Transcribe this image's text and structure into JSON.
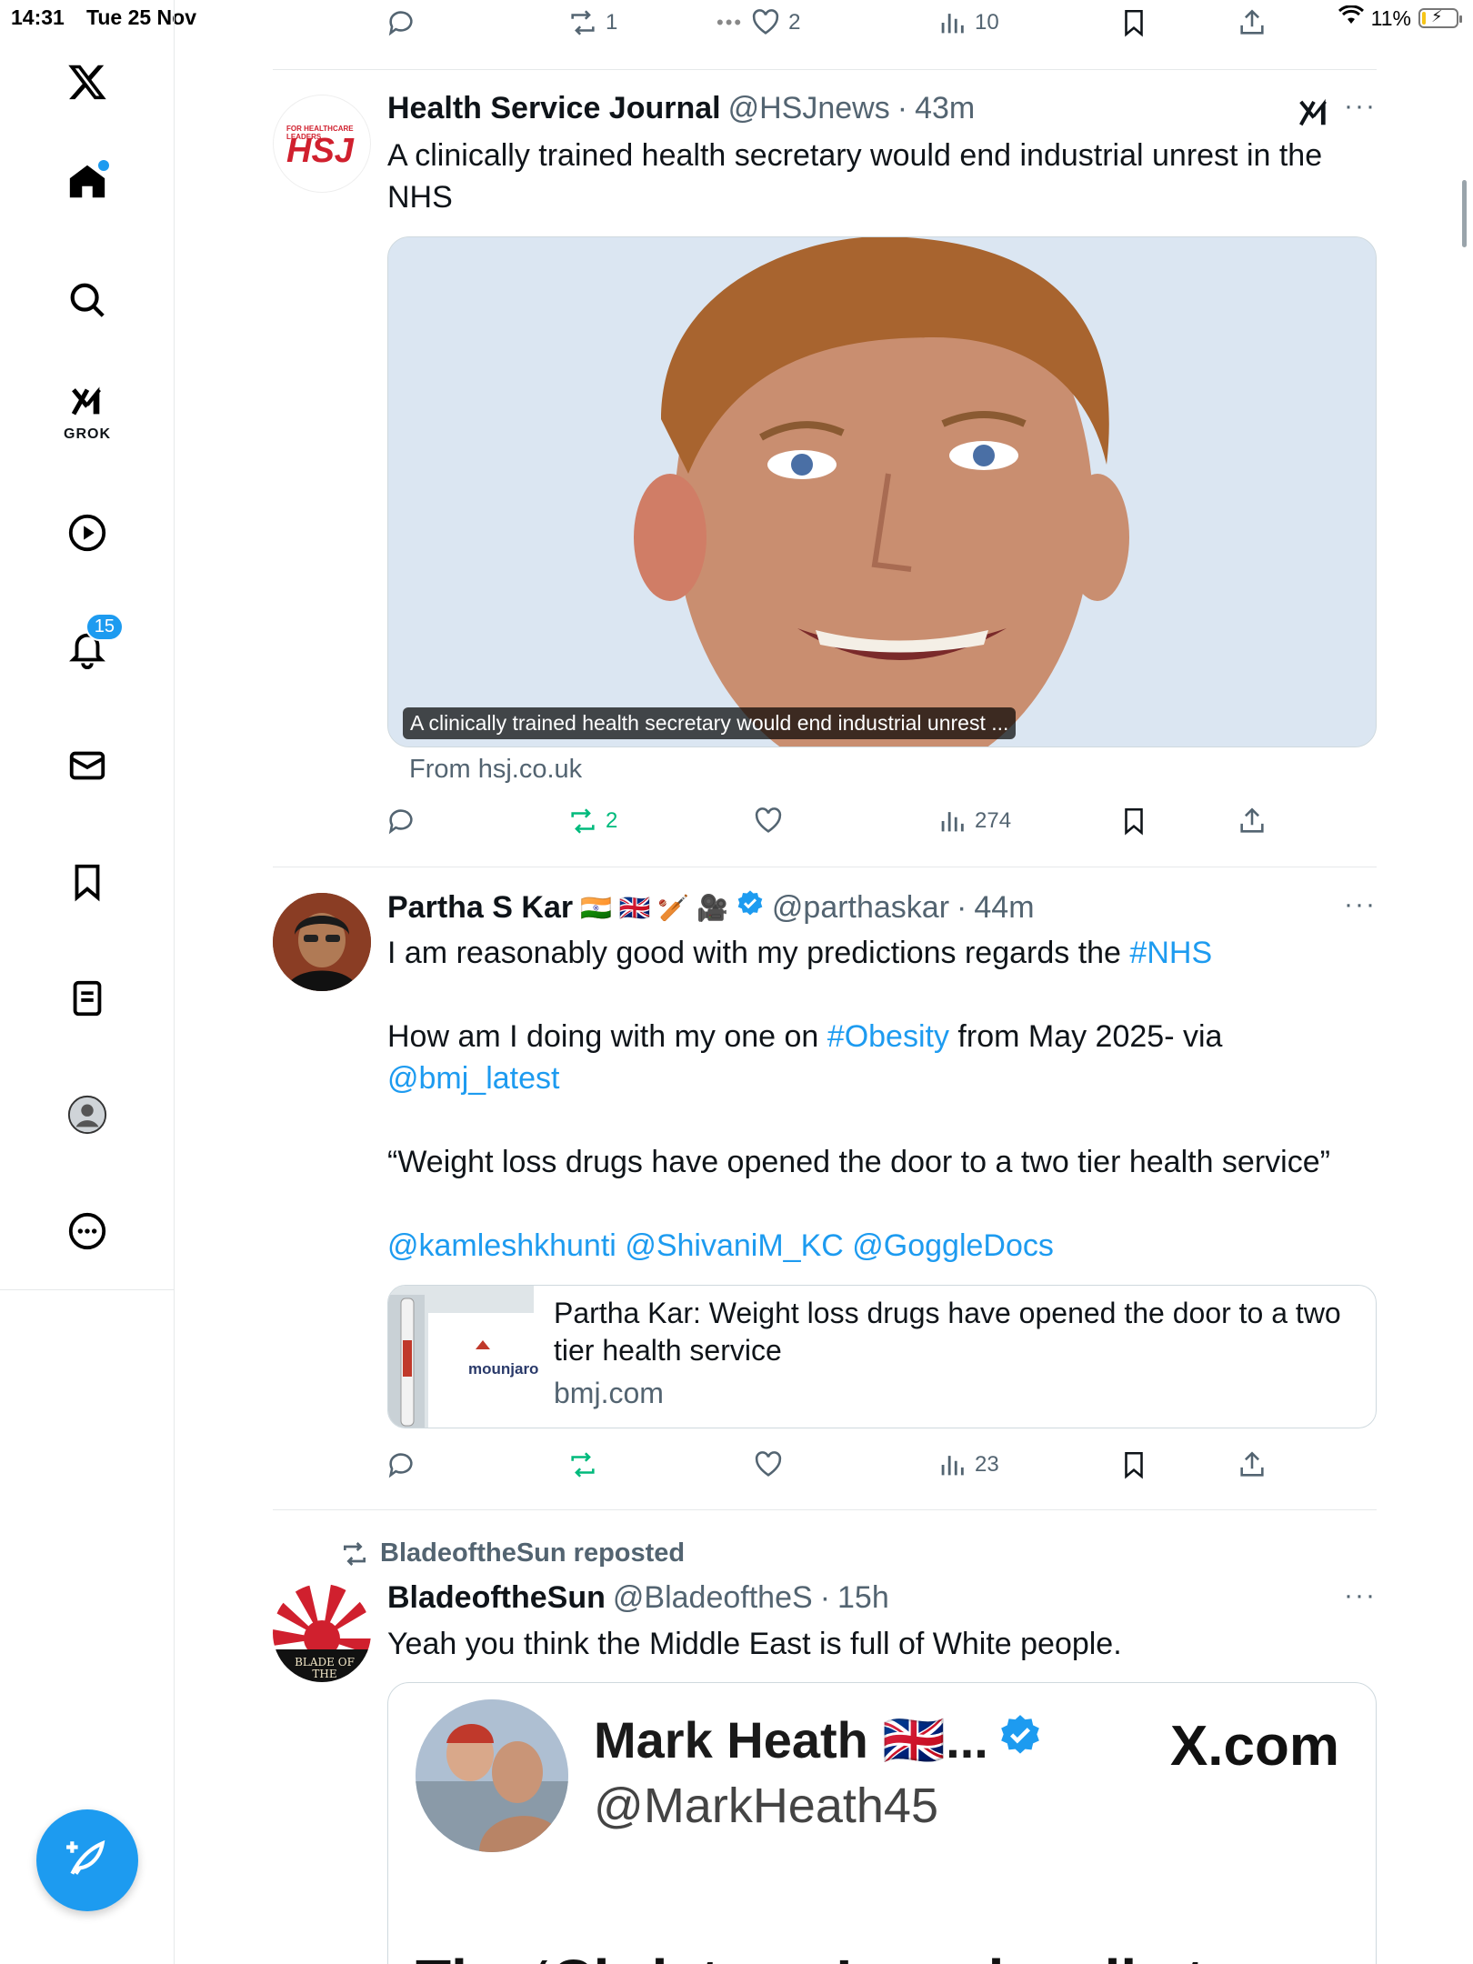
{
  "status_bar": {
    "time": "14:31",
    "date": "Tue 25 Nov",
    "battery": "11%",
    "battery_level": 0.11
  },
  "sidebar": {
    "grok_label": "GROK",
    "notifications_count": "15",
    "icons": [
      "x-logo-icon",
      "home-icon",
      "search-icon",
      "grok-icon",
      "video-icon",
      "bell-icon",
      "mail-icon",
      "bookmark-icon",
      "lists-icon",
      "profile-icon",
      "more-icon",
      "compose-icon"
    ]
  },
  "top_actions": {
    "reposts": "1",
    "likes": "2",
    "views": "10"
  },
  "posts": [
    {
      "name": "Health Service Journal",
      "handle": "@HSJnews",
      "sep": "·",
      "time": "43m",
      "avatar_text": "HSJ",
      "avatar_small": "FOR HEALTHCARE LEADERS",
      "text": "A clinically trained health secretary would end industrial unrest in the NHS",
      "media_caption": "A clinically trained health secretary would end industrial unrest ...",
      "from": "From hsj.co.uk",
      "actions": {
        "reposts": "2",
        "views": "274"
      }
    },
    {
      "name": "Partha S Kar",
      "flags": "🇮🇳 🇬🇧 🏏 🎥",
      "handle": "@parthaskar",
      "sep": "·",
      "time": "44m",
      "line1_a": "I am reasonably good with my predictions regards the ",
      "line1_tag": "#NHS",
      "line2_a": "How am I doing with my one on ",
      "line2_tag": "#Obesity",
      "line2_b": " from May 2025- via",
      "line3_mention": "@bmj_latest",
      "quote_line": "“Weight loss drugs have opened the door to a two tier health service”",
      "mentions": [
        "@kamleshkhunti",
        "@ShivaniM_KC",
        "@GoggleDocs"
      ],
      "card_title": "Partha Kar: Weight loss drugs have opened the door to a two tier health service",
      "card_domain": "bmj.com",
      "card_thumb_text": "mounjaro",
      "actions": {
        "views": "23"
      }
    },
    {
      "repost_label": "BladeoftheSun reposted",
      "name": "BladeoftheSun",
      "handle": "@BladeoftheS",
      "sep": "·",
      "time": "15h",
      "avatar_text": "BLADE OF THE",
      "text": "Yeah you think the Middle East is full of White people.",
      "quoted": {
        "name": "Mark Heath 🇬🇧...",
        "handle": "@MarkHeath45",
        "brand": "X.com",
        "cut_text": "The ‘Christmas’ royal mail stamp"
      }
    }
  ],
  "colors": {
    "accent": "#1d9bf0",
    "repost_green": "#00ba7c",
    "secondary_text": "#536471",
    "hsj_red": "#d0202e"
  }
}
